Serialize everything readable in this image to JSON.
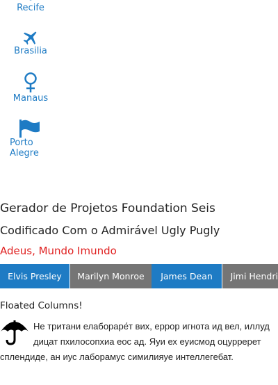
{
  "sidebar": {
    "items": [
      {
        "label": "Recife",
        "icon": "pin-icon"
      },
      {
        "label": "Brasilia",
        "icon": "airplane-icon"
      },
      {
        "label": "Manaus",
        "icon": "female-icon"
      },
      {
        "label": "Porto Alegre",
        "icon": "flag-icon"
      }
    ]
  },
  "headings": {
    "title": "Gerador de Projetos Foundation Seis",
    "subtitle": "Codificado Com o Admirável Ugly Pugly",
    "tagline": "Adeus, Mundo Imundo"
  },
  "buttons": [
    {
      "label": "Elvis Presley"
    },
    {
      "label": "Marilyn Monroe"
    },
    {
      "label": "James Dean"
    },
    {
      "label": "Jimi Hendrix"
    }
  ],
  "floated": {
    "title": "Floated Columns!",
    "icon": "umbrella-icon",
    "text": "Не тритани елабораре́т вих, еррор игнота ид вел, иллуд дицат пхилосопхиа еос ад. Яуи ех еуисмод оцурререт сплендиде, ан иус лaборамус симилияуе интеллегебат."
  },
  "colors": {
    "accent": "#1e7bc4",
    "secondary": "#757575",
    "alert": "#e02020"
  }
}
